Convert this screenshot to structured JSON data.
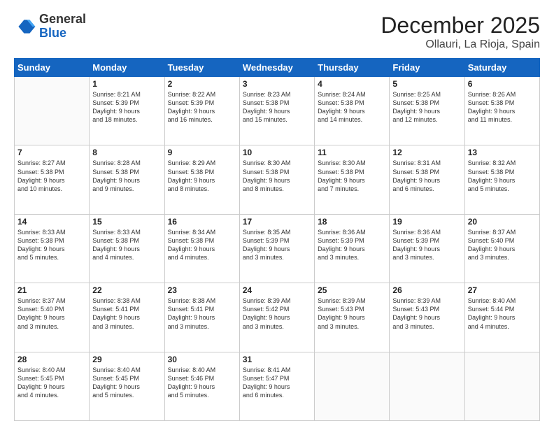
{
  "header": {
    "logo_general": "General",
    "logo_blue": "Blue",
    "month": "December 2025",
    "location": "Ollauri, La Rioja, Spain"
  },
  "weekdays": [
    "Sunday",
    "Monday",
    "Tuesday",
    "Wednesday",
    "Thursday",
    "Friday",
    "Saturday"
  ],
  "weeks": [
    [
      {
        "day": "",
        "info": ""
      },
      {
        "day": "1",
        "info": "Sunrise: 8:21 AM\nSunset: 5:39 PM\nDaylight: 9 hours\nand 18 minutes."
      },
      {
        "day": "2",
        "info": "Sunrise: 8:22 AM\nSunset: 5:39 PM\nDaylight: 9 hours\nand 16 minutes."
      },
      {
        "day": "3",
        "info": "Sunrise: 8:23 AM\nSunset: 5:38 PM\nDaylight: 9 hours\nand 15 minutes."
      },
      {
        "day": "4",
        "info": "Sunrise: 8:24 AM\nSunset: 5:38 PM\nDaylight: 9 hours\nand 14 minutes."
      },
      {
        "day": "5",
        "info": "Sunrise: 8:25 AM\nSunset: 5:38 PM\nDaylight: 9 hours\nand 12 minutes."
      },
      {
        "day": "6",
        "info": "Sunrise: 8:26 AM\nSunset: 5:38 PM\nDaylight: 9 hours\nand 11 minutes."
      }
    ],
    [
      {
        "day": "7",
        "info": "Sunrise: 8:27 AM\nSunset: 5:38 PM\nDaylight: 9 hours\nand 10 minutes."
      },
      {
        "day": "8",
        "info": "Sunrise: 8:28 AM\nSunset: 5:38 PM\nDaylight: 9 hours\nand 9 minutes."
      },
      {
        "day": "9",
        "info": "Sunrise: 8:29 AM\nSunset: 5:38 PM\nDaylight: 9 hours\nand 8 minutes."
      },
      {
        "day": "10",
        "info": "Sunrise: 8:30 AM\nSunset: 5:38 PM\nDaylight: 9 hours\nand 8 minutes."
      },
      {
        "day": "11",
        "info": "Sunrise: 8:30 AM\nSunset: 5:38 PM\nDaylight: 9 hours\nand 7 minutes."
      },
      {
        "day": "12",
        "info": "Sunrise: 8:31 AM\nSunset: 5:38 PM\nDaylight: 9 hours\nand 6 minutes."
      },
      {
        "day": "13",
        "info": "Sunrise: 8:32 AM\nSunset: 5:38 PM\nDaylight: 9 hours\nand 5 minutes."
      }
    ],
    [
      {
        "day": "14",
        "info": "Sunrise: 8:33 AM\nSunset: 5:38 PM\nDaylight: 9 hours\nand 5 minutes."
      },
      {
        "day": "15",
        "info": "Sunrise: 8:33 AM\nSunset: 5:38 PM\nDaylight: 9 hours\nand 4 minutes."
      },
      {
        "day": "16",
        "info": "Sunrise: 8:34 AM\nSunset: 5:38 PM\nDaylight: 9 hours\nand 4 minutes."
      },
      {
        "day": "17",
        "info": "Sunrise: 8:35 AM\nSunset: 5:39 PM\nDaylight: 9 hours\nand 3 minutes."
      },
      {
        "day": "18",
        "info": "Sunrise: 8:36 AM\nSunset: 5:39 PM\nDaylight: 9 hours\nand 3 minutes."
      },
      {
        "day": "19",
        "info": "Sunrise: 8:36 AM\nSunset: 5:39 PM\nDaylight: 9 hours\nand 3 minutes."
      },
      {
        "day": "20",
        "info": "Sunrise: 8:37 AM\nSunset: 5:40 PM\nDaylight: 9 hours\nand 3 minutes."
      }
    ],
    [
      {
        "day": "21",
        "info": "Sunrise: 8:37 AM\nSunset: 5:40 PM\nDaylight: 9 hours\nand 3 minutes."
      },
      {
        "day": "22",
        "info": "Sunrise: 8:38 AM\nSunset: 5:41 PM\nDaylight: 9 hours\nand 3 minutes."
      },
      {
        "day": "23",
        "info": "Sunrise: 8:38 AM\nSunset: 5:41 PM\nDaylight: 9 hours\nand 3 minutes."
      },
      {
        "day": "24",
        "info": "Sunrise: 8:39 AM\nSunset: 5:42 PM\nDaylight: 9 hours\nand 3 minutes."
      },
      {
        "day": "25",
        "info": "Sunrise: 8:39 AM\nSunset: 5:43 PM\nDaylight: 9 hours\nand 3 minutes."
      },
      {
        "day": "26",
        "info": "Sunrise: 8:39 AM\nSunset: 5:43 PM\nDaylight: 9 hours\nand 3 minutes."
      },
      {
        "day": "27",
        "info": "Sunrise: 8:40 AM\nSunset: 5:44 PM\nDaylight: 9 hours\nand 4 minutes."
      }
    ],
    [
      {
        "day": "28",
        "info": "Sunrise: 8:40 AM\nSunset: 5:45 PM\nDaylight: 9 hours\nand 4 minutes."
      },
      {
        "day": "29",
        "info": "Sunrise: 8:40 AM\nSunset: 5:45 PM\nDaylight: 9 hours\nand 5 minutes."
      },
      {
        "day": "30",
        "info": "Sunrise: 8:40 AM\nSunset: 5:46 PM\nDaylight: 9 hours\nand 5 minutes."
      },
      {
        "day": "31",
        "info": "Sunrise: 8:41 AM\nSunset: 5:47 PM\nDaylight: 9 hours\nand 6 minutes."
      },
      {
        "day": "",
        "info": ""
      },
      {
        "day": "",
        "info": ""
      },
      {
        "day": "",
        "info": ""
      }
    ]
  ]
}
